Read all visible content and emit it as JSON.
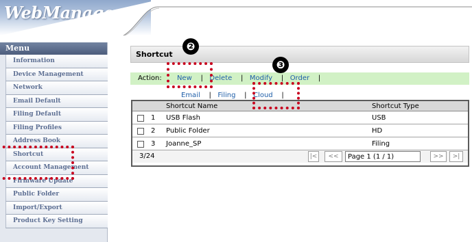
{
  "app": {
    "logo": "WebManager"
  },
  "sidebar": {
    "title": "Menu",
    "items": [
      {
        "label": "Information"
      },
      {
        "label": "Device Management"
      },
      {
        "label": "Network"
      },
      {
        "label": "Email Default"
      },
      {
        "label": "Filing Default"
      },
      {
        "label": "Filing Profiles"
      },
      {
        "label": "Address Book"
      },
      {
        "label": "Shortcut"
      },
      {
        "label": "Account Management"
      },
      {
        "label": "Firmware Update"
      },
      {
        "label": "Public Folder"
      },
      {
        "label": "Import/Export"
      },
      {
        "label": "Product Key Setting"
      }
    ]
  },
  "section": {
    "title": "Shortcut"
  },
  "actions": {
    "label": "Action:",
    "new": "New",
    "delete": "Delete",
    "modify": "Modify",
    "order": "Order",
    "sep": "|"
  },
  "tabs": {
    "email": "Email",
    "filing": "Filing",
    "cloud": "Cloud",
    "sep": "|"
  },
  "table": {
    "headers": {
      "name": "Shortcut Name",
      "type": "Shortcut Type"
    },
    "rows": [
      {
        "index": "1",
        "name": "USB Flash",
        "type": "USB"
      },
      {
        "index": "2",
        "name": "Public Folder",
        "type": "HD"
      },
      {
        "index": "3",
        "name": "Joanne_SP",
        "type": "Filing"
      }
    ],
    "count": "3/24",
    "pager": {
      "first": "|<",
      "prev": "<<",
      "page": "Page 1 (1 / 1)",
      "next": ">>",
      "last": ">|"
    }
  },
  "annotations": {
    "badge2": "❷",
    "badge3": "❸",
    "color": "#c8001e"
  }
}
